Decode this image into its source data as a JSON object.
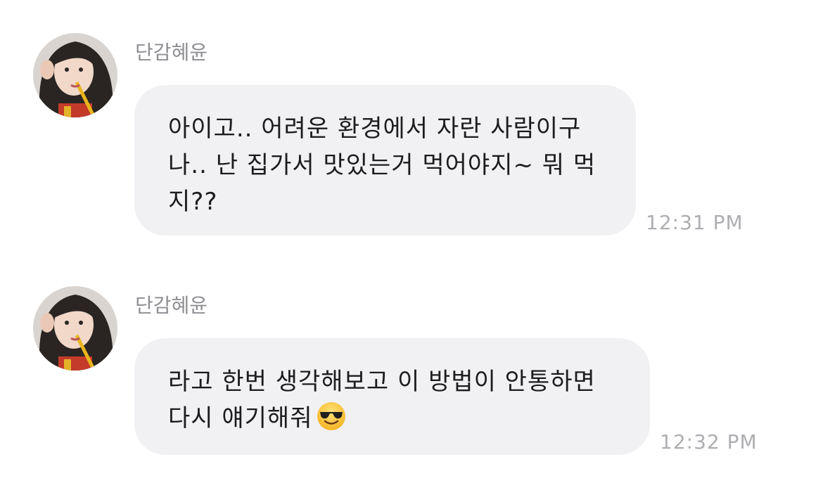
{
  "messages": [
    {
      "sender": "단감혜윤",
      "avatar_icon": "profile-photo",
      "lines": [
        "아이고.. 어려운 환경에서 자란 사람이구",
        "나.. 난 집가서 맛있는거 먹어야지~ 뭐 먹",
        "지??"
      ],
      "time": "12:31 PM"
    },
    {
      "sender": "단감혜윤",
      "avatar_icon": "profile-photo",
      "lines": [
        "라고 한번 생각해보고 이 방법이 안통하면",
        "다시 얘기해줘"
      ],
      "emoji": "smiling-face-with-sunglasses-icon",
      "time": "12:32 PM"
    }
  ],
  "colors": {
    "bubble": "#f1f1f4",
    "text": "#1c1c1e",
    "sender": "#8e8e93",
    "time": "#aeaeb2"
  }
}
